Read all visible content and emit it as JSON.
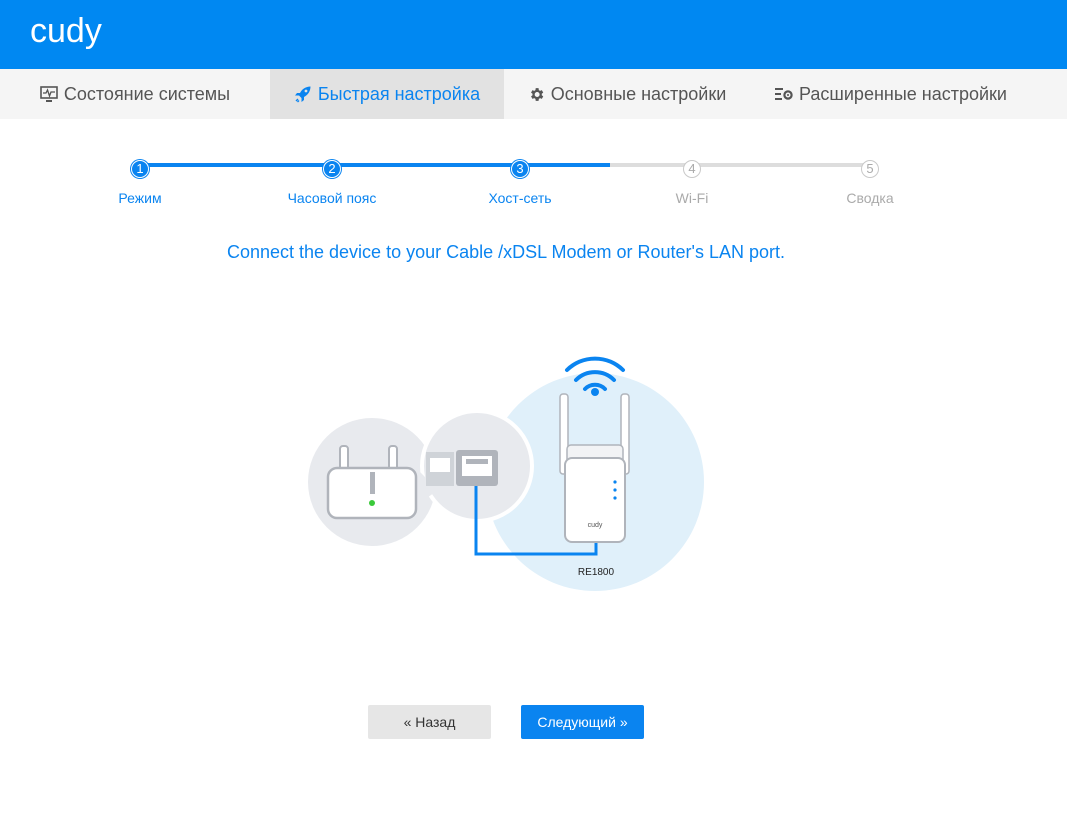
{
  "brand": {
    "logo_text": "cudy",
    "primary_color": "#0088f2",
    "accent_color": "#0a84f0"
  },
  "nav": {
    "items": [
      {
        "label": "Состояние системы",
        "icon": "monitor-icon",
        "active": false
      },
      {
        "label": "Быстрая настройка",
        "icon": "rocket-icon",
        "active": true
      },
      {
        "label": "Основные настройки",
        "icon": "gear-icon",
        "active": false
      },
      {
        "label": "Расширенные настройки",
        "icon": "advanced-settings-icon",
        "active": false
      }
    ]
  },
  "wizard": {
    "current_step": 3,
    "steps": [
      {
        "number": "1",
        "label": "Режим",
        "done": true
      },
      {
        "number": "2",
        "label": "Часовой пояс",
        "done": true
      },
      {
        "number": "3",
        "label": "Хост-сеть",
        "done": true
      },
      {
        "number": "4",
        "label": "Wi-Fi",
        "done": false
      },
      {
        "number": "5",
        "label": "Сводка",
        "done": false
      }
    ],
    "instruction": "Connect the device to your Cable /xDSL Modem or Router's LAN port.",
    "device_model": "RE1800",
    "device_brand": "cudy",
    "back_label": "« Назад",
    "next_label": "Следующий »"
  }
}
